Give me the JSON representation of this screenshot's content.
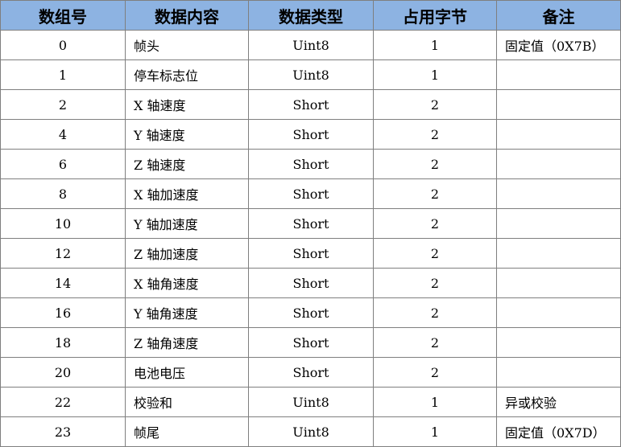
{
  "headers": [
    "数组号",
    "数据内容",
    "数据类型",
    "占用字节",
    "备注"
  ],
  "rows": [
    {
      "index": "0",
      "content": "帧头",
      "type": "Uint8",
      "bytes": "1",
      "note": "固定值（0X7B）"
    },
    {
      "index": "1",
      "content": "停车标志位",
      "type": "Uint8",
      "bytes": "1",
      "note": ""
    },
    {
      "index": "2",
      "content": "X 轴速度",
      "type": "Short",
      "bytes": "2",
      "note": ""
    },
    {
      "index": "4",
      "content": "Y 轴速度",
      "type": "Short",
      "bytes": "2",
      "note": ""
    },
    {
      "index": "6",
      "content": "Z 轴速度",
      "type": "Short",
      "bytes": "2",
      "note": ""
    },
    {
      "index": "8",
      "content": "X 轴加速度",
      "type": "Short",
      "bytes": "2",
      "note": ""
    },
    {
      "index": "10",
      "content": "Y 轴加速度",
      "type": "Short",
      "bytes": "2",
      "note": ""
    },
    {
      "index": "12",
      "content": "Z 轴加速度",
      "type": "Short",
      "bytes": "2",
      "note": ""
    },
    {
      "index": "14",
      "content": "X 轴角速度",
      "type": "Short",
      "bytes": "2",
      "note": ""
    },
    {
      "index": "16",
      "content": "Y 轴角速度",
      "type": "Short",
      "bytes": "2",
      "note": ""
    },
    {
      "index": "18",
      "content": "Z 轴角速度",
      "type": "Short",
      "bytes": "2",
      "note": ""
    },
    {
      "index": "20",
      "content": "电池电压",
      "type": "Short",
      "bytes": "2",
      "note": ""
    },
    {
      "index": "22",
      "content": "校验和",
      "type": "Uint8",
      "bytes": "1",
      "note": "异或校验"
    },
    {
      "index": "23",
      "content": "帧尾",
      "type": "Uint8",
      "bytes": "1",
      "note": "固定值（0X7D）"
    }
  ],
  "colors": {
    "header_bg": "#8db3e2",
    "border": "#7f7f7f"
  }
}
